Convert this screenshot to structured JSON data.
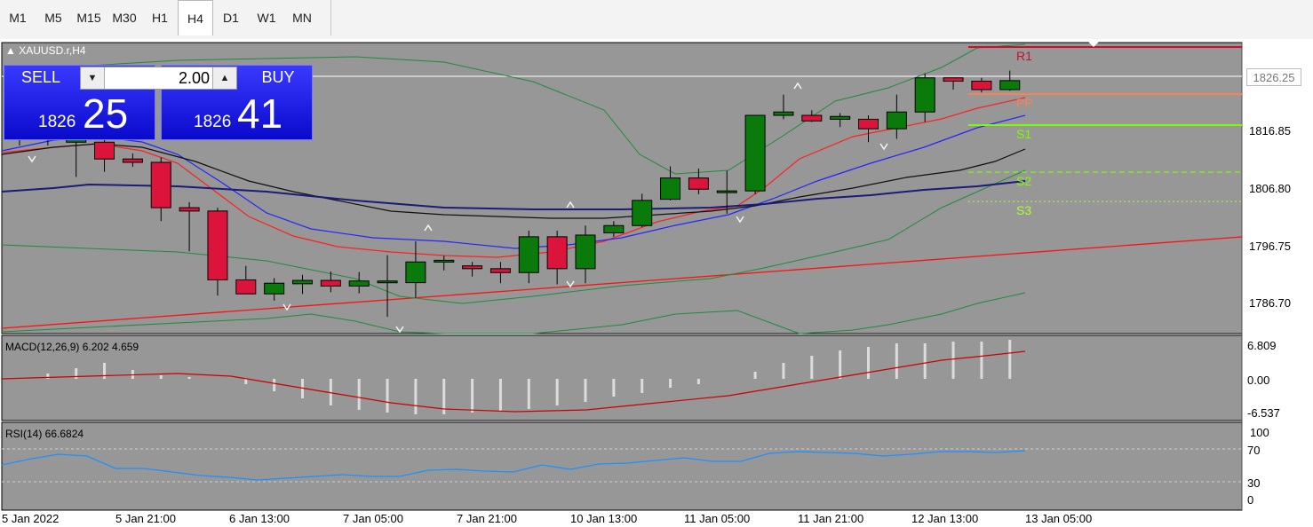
{
  "toolbar": {
    "timeframes": [
      "M1",
      "M5",
      "M15",
      "M30",
      "H1",
      "H4",
      "D1",
      "W1",
      "MN"
    ],
    "active_index": 5
  },
  "chart": {
    "symbol_label": "XAUUSD.r,H4",
    "price_labels": [
      "1816.85",
      "1806.80",
      "1796.75",
      "1786.70"
    ],
    "current_price": "1826.25",
    "pivots": [
      {
        "name": "R1",
        "color": "#c8102e",
        "style": "solid"
      },
      {
        "name": "PP",
        "color": "#ff7f50",
        "style": "solid"
      },
      {
        "name": "S1",
        "color": "#7cfc00",
        "style": "solid"
      },
      {
        "name": "S2",
        "color": "#7cfc00",
        "style": "dashed"
      },
      {
        "name": "S3",
        "color": "#adff2f",
        "style": "dotted"
      }
    ],
    "date_labels": [
      "5 Jan 2022",
      "5 Jan 21:00",
      "6 Jan 13:00",
      "7 Jan 05:00",
      "7 Jan 21:00",
      "10 Jan 13:00",
      "11 Jan 05:00",
      "11 Jan 21:00",
      "12 Jan 13:00",
      "13 Jan 05:00"
    ]
  },
  "trade_panel": {
    "sell_label": "SELL",
    "buy_label": "BUY",
    "lot": "2.00",
    "sell_small": "1826",
    "sell_big": "25",
    "buy_small": "1826",
    "buy_big": "41"
  },
  "macd": {
    "label": "MACD(12,26,9) 6.202 4.659",
    "levels": [
      "6.809",
      "0.00",
      "-6.537"
    ]
  },
  "rsi": {
    "label": "RSI(14) 66.6824",
    "levels": [
      "100",
      "70",
      "30",
      "0"
    ]
  },
  "colors": {
    "chart_bg": "#979797",
    "bull": "#0a7a0a",
    "bear": "#dc143c",
    "ma_fast": "#ff2020",
    "ma_mid": "#2525ff",
    "ma_slow": "#101010",
    "ma_long": "#1b1b7a",
    "bb": "#1e8c3c",
    "trend": "#ff1010",
    "signal": "#cc0000",
    "rsi": "#1e90ff"
  },
  "chart_data": {
    "type": "candlestick",
    "y_range": [
      1781,
      1833
    ],
    "candles": [
      {
        "o": 1818.0,
        "h": 1821.0,
        "l": 1814.6,
        "c": 1816.0
      },
      {
        "o": 1816.0,
        "h": 1818.0,
        "l": 1814.6,
        "c": 1818.6
      },
      {
        "o": 1815.2,
        "h": 1822.0,
        "l": 1809.0,
        "c": 1818.6
      },
      {
        "o": 1815.2,
        "h": 1816.0,
        "l": 1809.9,
        "c": 1812.2
      },
      {
        "o": 1812.2,
        "h": 1813.2,
        "l": 1810.8,
        "c": 1811.6
      },
      {
        "o": 1811.6,
        "h": 1812.5,
        "l": 1801.1,
        "c": 1803.5
      },
      {
        "o": 1803.5,
        "h": 1804.5,
        "l": 1795.7,
        "c": 1802.9
      },
      {
        "o": 1802.9,
        "h": 1803.5,
        "l": 1787.8,
        "c": 1790.6
      },
      {
        "o": 1790.6,
        "h": 1793.1,
        "l": 1788.9,
        "c": 1788.1
      },
      {
        "o": 1788.1,
        "h": 1790.9,
        "l": 1786.9,
        "c": 1790.0
      },
      {
        "o": 1789.9,
        "h": 1791.5,
        "l": 1788.1,
        "c": 1790.5
      },
      {
        "o": 1790.5,
        "h": 1792.1,
        "l": 1788.4,
        "c": 1789.5
      },
      {
        "o": 1789.5,
        "h": 1792.0,
        "l": 1788.2,
        "c": 1790.4
      },
      {
        "o": 1790.1,
        "h": 1795.0,
        "l": 1784.0,
        "c": 1790.4
      },
      {
        "o": 1790.1,
        "h": 1797.5,
        "l": 1787.4,
        "c": 1793.8
      },
      {
        "o": 1793.8,
        "h": 1794.9,
        "l": 1792.3,
        "c": 1794.1
      },
      {
        "o": 1793.1,
        "h": 1793.8,
        "l": 1791.2,
        "c": 1792.6
      },
      {
        "o": 1792.6,
        "h": 1793.8,
        "l": 1790.0,
        "c": 1791.9
      },
      {
        "o": 1791.9,
        "h": 1799.4,
        "l": 1790.0,
        "c": 1798.3
      },
      {
        "o": 1798.3,
        "h": 1799.4,
        "l": 1789.8,
        "c": 1792.6
      },
      {
        "o": 1792.6,
        "h": 1800.3,
        "l": 1790.0,
        "c": 1798.6
      },
      {
        "o": 1799.0,
        "h": 1801.1,
        "l": 1798.3,
        "c": 1800.3
      },
      {
        "o": 1800.3,
        "h": 1806.0,
        "l": 1800.0,
        "c": 1804.8
      },
      {
        "o": 1805.0,
        "h": 1810.9,
        "l": 1804.8,
        "c": 1808.8
      },
      {
        "o": 1808.8,
        "h": 1810.5,
        "l": 1805.9,
        "c": 1806.8
      },
      {
        "o": 1806.5,
        "h": 1810.1,
        "l": 1802.4,
        "c": 1806.5
      },
      {
        "o": 1806.5,
        "h": 1815.3,
        "l": 1805.9,
        "c": 1820.0
      },
      {
        "o": 1820.0,
        "h": 1823.7,
        "l": 1819.3,
        "c": 1820.6
      },
      {
        "o": 1820.0,
        "h": 1820.9,
        "l": 1818.8,
        "c": 1819.0
      },
      {
        "o": 1819.3,
        "h": 1820.4,
        "l": 1817.9,
        "c": 1819.8
      },
      {
        "o": 1819.3,
        "h": 1820.0,
        "l": 1815.2,
        "c": 1817.6
      },
      {
        "o": 1817.6,
        "h": 1823.7,
        "l": 1815.8,
        "c": 1820.6
      },
      {
        "o": 1820.6,
        "h": 1827.5,
        "l": 1818.8,
        "c": 1826.7
      },
      {
        "o": 1826.7,
        "h": 1826.7,
        "l": 1824.6,
        "c": 1826.1
      },
      {
        "o": 1826.1,
        "h": 1826.7,
        "l": 1824.1,
        "c": 1824.6
      },
      {
        "o": 1824.6,
        "h": 1828.0,
        "l": 1824.4,
        "c": 1826.2
      }
    ]
  }
}
